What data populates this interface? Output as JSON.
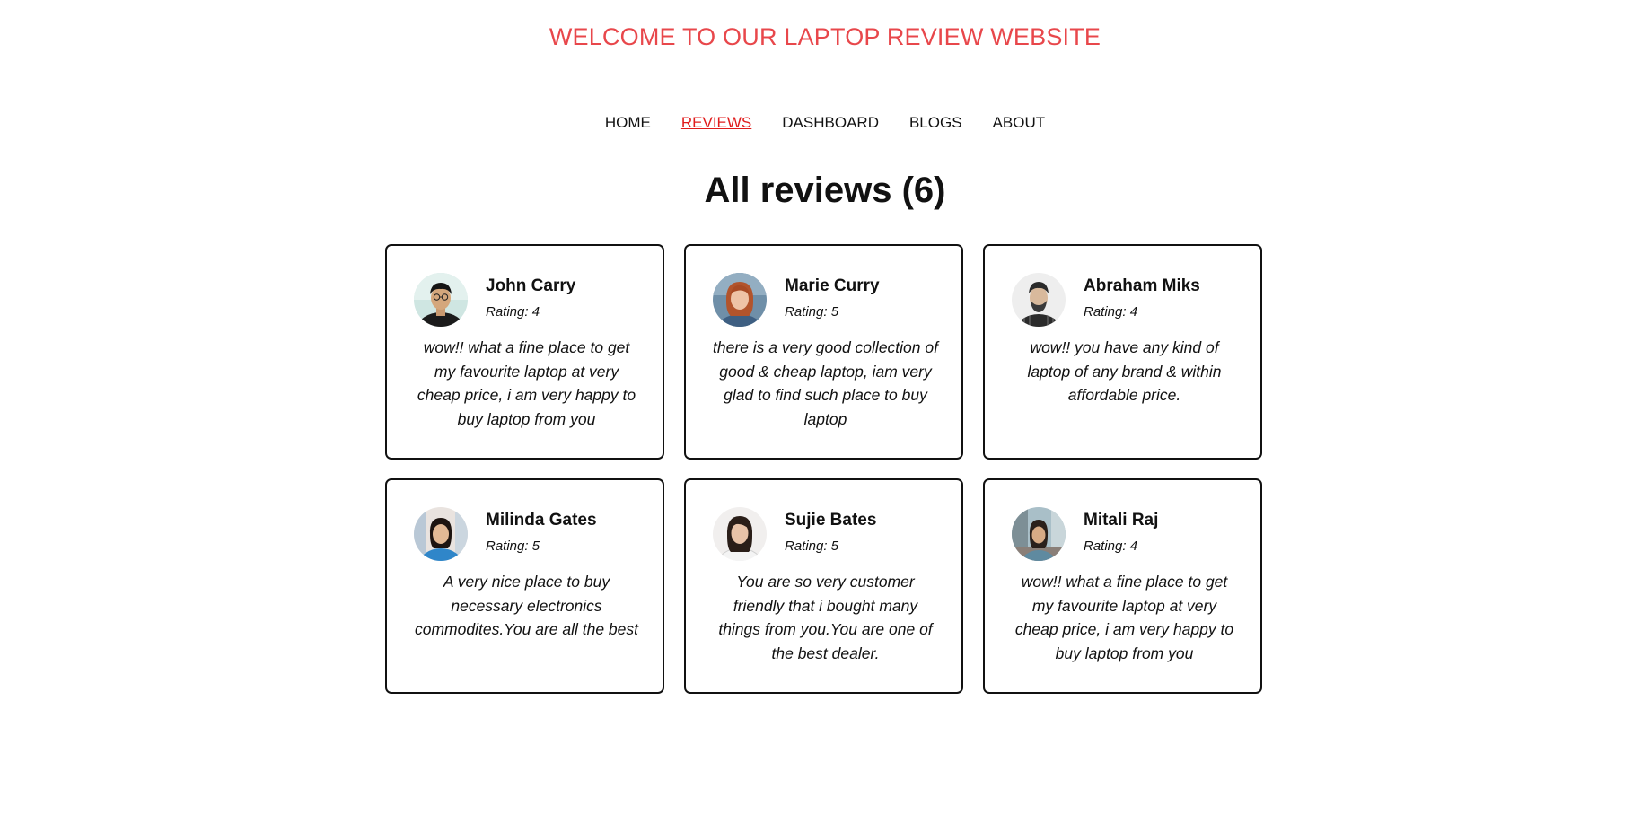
{
  "site": {
    "title": "WELCOME TO OUR LAPTOP REVIEW WEBSITE"
  },
  "nav": {
    "items": [
      {
        "label": "HOME"
      },
      {
        "label": "REVIEWS",
        "active": true
      },
      {
        "label": "DASHBOARD"
      },
      {
        "label": "BLOGS"
      },
      {
        "label": "ABOUT"
      }
    ]
  },
  "main": {
    "heading": "All reviews (6)"
  },
  "reviews": [
    {
      "name": "John Carry",
      "rating": "Rating: 4",
      "text": "wow!! what a fine place to get my favourite laptop at very cheap price, i am very happy to buy laptop from you",
      "avatar": "man-glasses-avatar"
    },
    {
      "name": "Marie Curry",
      "rating": "Rating: 5",
      "text": "there is a very good collection of good & cheap laptop, iam very glad to find such place to buy laptop",
      "avatar": "woman-red-hair-avatar"
    },
    {
      "name": "Abraham Miks",
      "rating": "Rating: 4",
      "text": "wow!! you have any kind of laptop of any brand & within affordable price.",
      "avatar": "bearded-man-avatar"
    },
    {
      "name": "Milinda Gates",
      "rating": "Rating: 5",
      "text": "A very nice place to buy necessary electronics commodites.You are all the best",
      "avatar": "woman-blue-shirt-avatar"
    },
    {
      "name": "Sujie Bates",
      "rating": "Rating: 5",
      "text": "You are so very customer friendly that i bought many things from you.You are one of the best dealer.",
      "avatar": "woman-dark-hair-avatar"
    },
    {
      "name": "Mitali Raj",
      "rating": "Rating: 4",
      "text": "wow!! what a fine place to get my favourite laptop at very cheap price, i am very happy to buy laptop from you",
      "avatar": "woman-street-avatar"
    }
  ],
  "colors": {
    "title": "#e8474b",
    "active_nav": "#e01b1b",
    "text": "#111111",
    "card_border": "#111111"
  }
}
